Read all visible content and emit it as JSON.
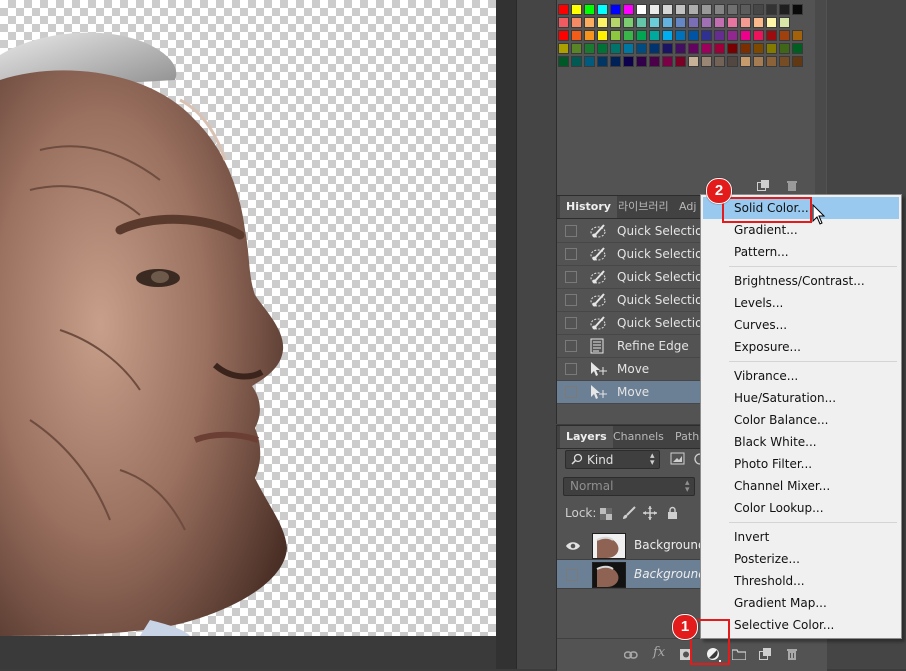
{
  "colors": {
    "accent_red": "#e31b1b",
    "selection_blue": "#6b7f95",
    "menu_hover": "#99c9ef"
  },
  "swatches": {
    "rows": [
      [
        "#ff0000",
        "#ffff00",
        "#00ff00",
        "#00ffff",
        "#0000ff",
        "#ff00ff",
        "#ffffff",
        "#ebebeb",
        "#d6d6d6",
        "#c2c2c2",
        "#adadad",
        "#999999",
        "#858585",
        "#707070",
        "#5c5c5c",
        "#474747",
        "#333333",
        "#1f1f1f",
        "#0a0a0a"
      ],
      [
        "#f05a61",
        "#f58a64",
        "#faad5f",
        "#fdf367",
        "#b6d66a",
        "#7ccc70",
        "#63c6a9",
        "#6acdd8",
        "#64b2e0",
        "#6588c4",
        "#7a6eb6",
        "#9f71b4",
        "#c26fb1",
        "#e8759f",
        "#f39a92",
        "#fbb98b",
        "#fff6a7",
        "#d8e7a7"
      ],
      [
        "#ff0000",
        "#f25c19",
        "#f7941d",
        "#fff200",
        "#8dc63f",
        "#39b54a",
        "#00a651",
        "#00a99d",
        "#00aeef",
        "#0072bc",
        "#0054a6",
        "#2e3192",
        "#662d91",
        "#92278f",
        "#ec008c",
        "#ed145b",
        "#9e0b0f",
        "#a0410d",
        "#a36209"
      ],
      [
        "#aba000",
        "#598527",
        "#1a7b30",
        "#007236",
        "#00746b",
        "#0076a3",
        "#004b80",
        "#003471",
        "#1b1464",
        "#440e62",
        "#630460",
        "#9e005d",
        "#9e0039",
        "#790000",
        "#7b2e00",
        "#7d4900",
        "#827b00",
        "#406618",
        "#005e20"
      ],
      [
        "#005826",
        "#005952",
        "#005b7f",
        "#003663",
        "#002157",
        "#0d004c",
        "#32004b",
        "#4b0049",
        "#7b0046",
        "#7a0026",
        "#c7b299",
        "#998675",
        "#736357",
        "#534741",
        "#c69c6d",
        "#a67c52",
        "#8c6239",
        "#754c24",
        "#603913"
      ]
    ]
  },
  "history": {
    "tabs": [
      "History",
      "라이브러리",
      "Adj"
    ],
    "items": [
      {
        "label": "Quick Selection",
        "icon": "quick-selection-icon"
      },
      {
        "label": "Quick Selection",
        "icon": "quick-selection-icon"
      },
      {
        "label": "Quick Selection",
        "icon": "quick-selection-icon"
      },
      {
        "label": "Quick Selection",
        "icon": "quick-selection-icon"
      },
      {
        "label": "Quick Selection",
        "icon": "quick-selection-icon"
      },
      {
        "label": "Refine Edge",
        "icon": "refine-edge-icon"
      },
      {
        "label": "Move",
        "icon": "move-tool-icon"
      },
      {
        "label": "Move",
        "icon": "move-tool-icon"
      }
    ]
  },
  "layers": {
    "tabs": [
      "Layers",
      "Channels",
      "Path"
    ],
    "filter": "Kind",
    "blend_mode": "Normal",
    "lock_label": "Lock:",
    "rows": [
      {
        "name": "Background",
        "italic": false
      },
      {
        "name": "Background",
        "italic": true
      }
    ]
  },
  "menu": {
    "groups": [
      [
        "Solid Color...",
        "Gradient...",
        "Pattern..."
      ],
      [
        "Brightness/Contrast...",
        "Levels...",
        "Curves...",
        "Exposure..."
      ],
      [
        "Vibrance...",
        "Hue/Saturation...",
        "Color Balance...",
        "Black  White...",
        "Photo Filter...",
        "Channel Mixer...",
        "Color Lookup..."
      ],
      [
        "Invert",
        "Posterize...",
        "Threshold...",
        "Gradient Map...",
        "Selective Color..."
      ]
    ],
    "hovered": "Solid Color..."
  },
  "annotations": {
    "step1": "1",
    "step2": "2"
  }
}
